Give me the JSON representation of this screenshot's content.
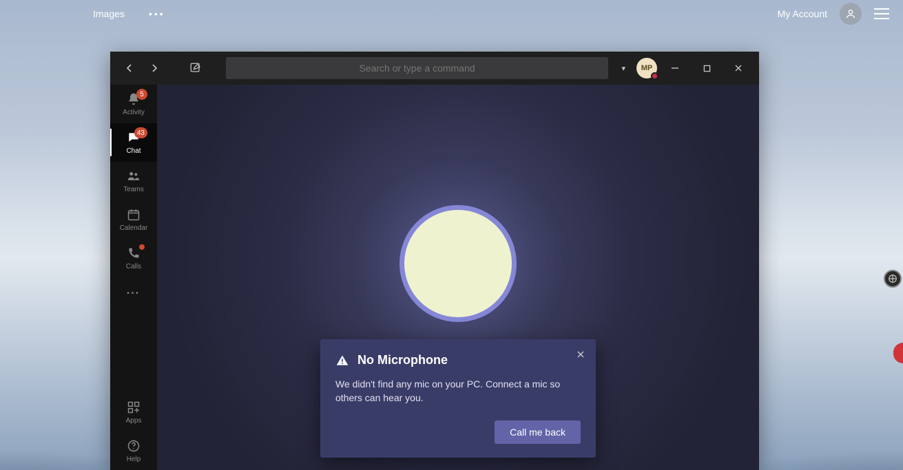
{
  "browser": {
    "images_label": "Images",
    "account_label": "My Account"
  },
  "teams": {
    "search_placeholder": "Search or type a command",
    "profile_initials": "MP",
    "rail": [
      {
        "label": "Activity",
        "badge": "5"
      },
      {
        "label": "Chat",
        "badge": "43"
      },
      {
        "label": "Teams",
        "badge": ""
      },
      {
        "label": "Calendar",
        "badge": ""
      },
      {
        "label": "Calls",
        "badge": ""
      },
      {
        "label": "Apps",
        "badge": ""
      },
      {
        "label": "Help",
        "badge": ""
      }
    ],
    "dialog": {
      "title": "No Microphone",
      "body": "We didn't find any mic on your PC. Connect a mic so others can hear you.",
      "primary": "Call me back"
    }
  }
}
